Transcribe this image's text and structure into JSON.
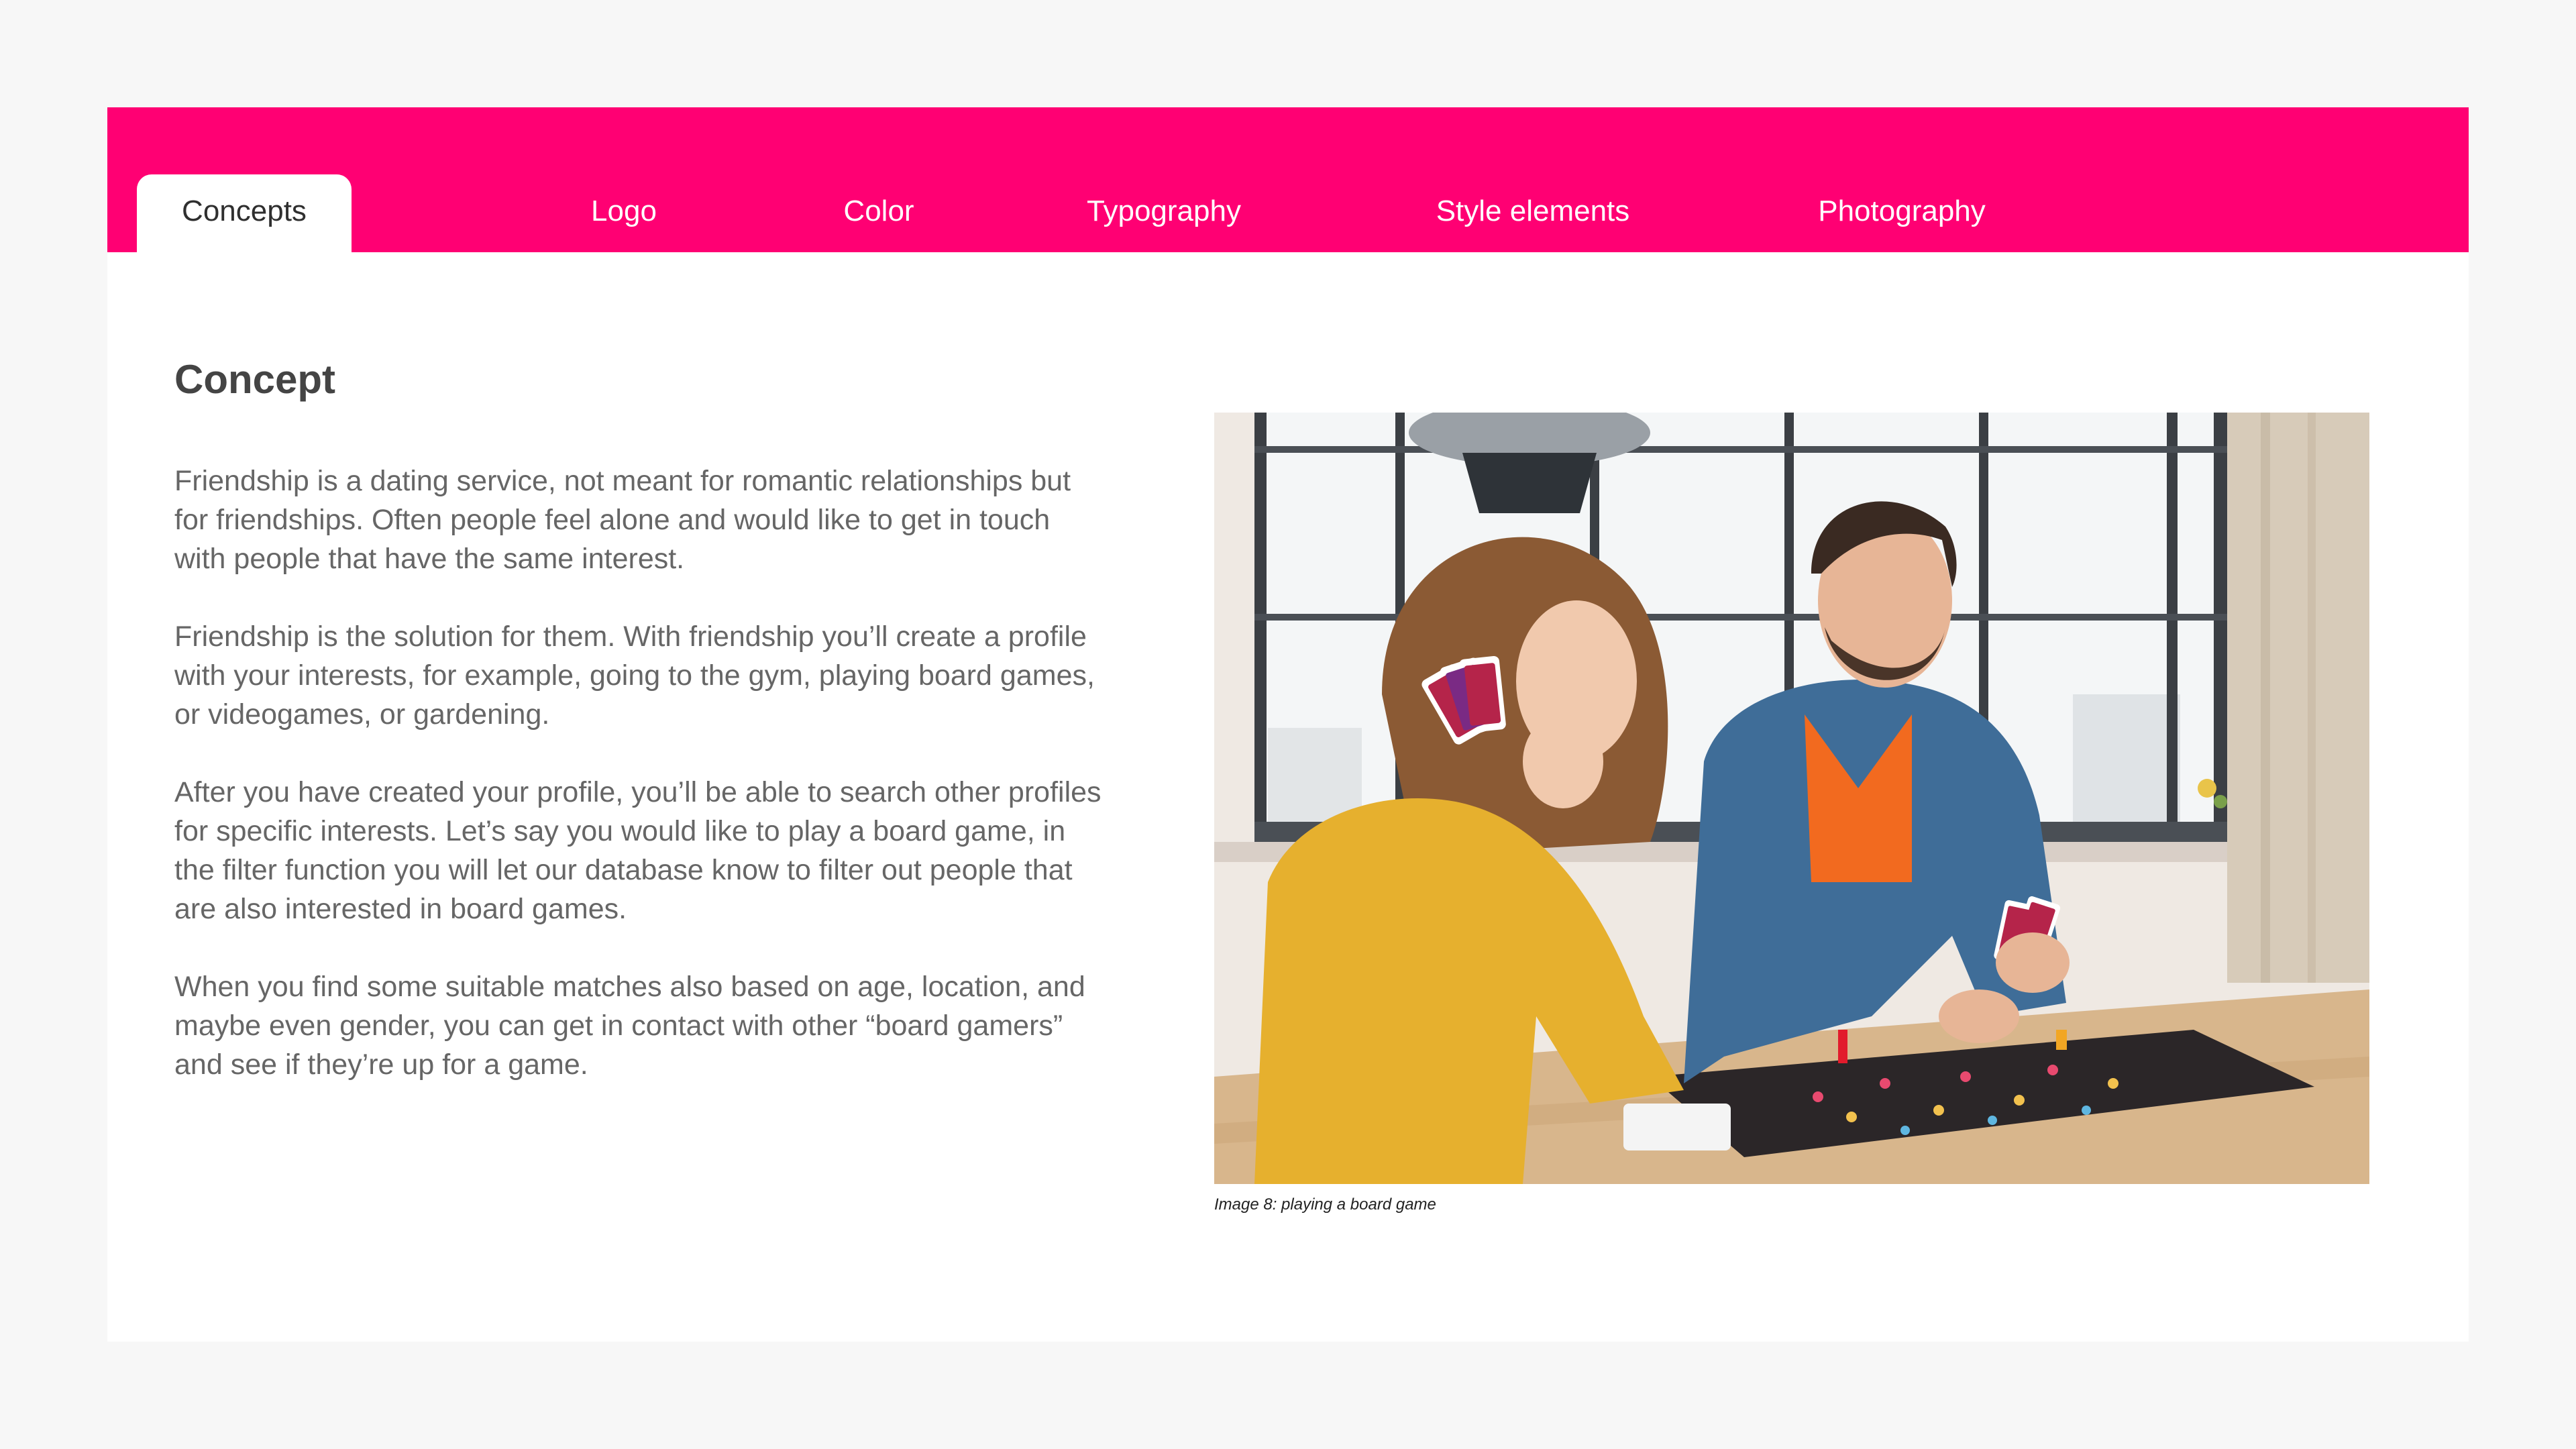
{
  "tabs": [
    {
      "label": "Concepts",
      "active": true
    },
    {
      "label": "Logo",
      "active": false
    },
    {
      "label": "Color",
      "active": false
    },
    {
      "label": "Typography",
      "active": false
    },
    {
      "label": "Style elements",
      "active": false
    },
    {
      "label": "Photography",
      "active": false
    }
  ],
  "content": {
    "heading": "Concept",
    "paragraphs": [
      "Friendship is a dating service, not meant for romantic relationships but for friendships. Often people feel alone and would like to get in touch with people that have the same interest.",
      "Friendship is the solution for them. With friendship you’ll create a profile with your interests, for example, going to the gym, playing board games, or videogames, or gardening.",
      "After you have created your profile, you’ll be able to search other profiles for specific interests. Let’s say you would like to play a board game, in the filter function you will let our database know to filter out people that are also interested in board games.",
      "When you find some suitable matches also based on age, location, and maybe even gender, you can get in contact with other “board gamers” and see if they’re up for a game."
    ]
  },
  "image": {
    "caption": "Image 8: playing a board game"
  },
  "colors": {
    "accent": "#ff0073",
    "page_background": "#f7f7f7",
    "panel_background": "#ffffff",
    "heading_text": "#444444",
    "body_text": "#666666"
  }
}
